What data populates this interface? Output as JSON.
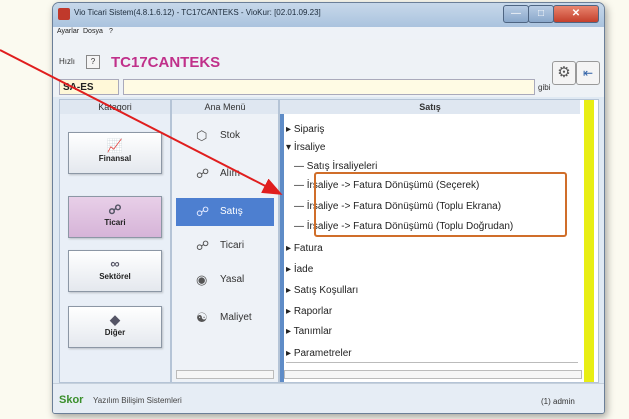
{
  "window": {
    "title": "Vio Ticari Sistem(4.8.1.6.12) - TC17CANTEKS - VioKur: [02.01.09.23]"
  },
  "menubar": {
    "items": [
      "Ayarlar",
      "Dosya",
      "?"
    ]
  },
  "toolbar": {
    "hizli_label": "Hızlı",
    "help_label": "?",
    "company": "TC17CANTEKS",
    "code": "SA-ES",
    "search_value": "",
    "gibi_label": "gibi"
  },
  "kategori": {
    "header": "Kategori",
    "items": [
      "Finansal",
      "Ticari",
      "Sektörel",
      "Diğer"
    ],
    "active": "Ticari"
  },
  "anamenu": {
    "header": "Ana Menü",
    "items": [
      "Stok",
      "Alım",
      "Satış",
      "Ticari",
      "Yasal",
      "Maliyet"
    ],
    "active": "Satış"
  },
  "satis": {
    "header": "Satış",
    "tree": [
      "Sipariş",
      "İrsaliye",
      "Satış İrsaliyeleri",
      "İrsaliye -> Fatura Dönüşümü (Seçerek)",
      "İrsaliye -> Fatura Dönüşümü (Toplu Ekrana)",
      "İrsaliye -> Fatura Dönüşümü (Toplu Doğrudan)",
      "Fatura",
      "İade",
      "Satış Koşulları",
      "Raporlar",
      "Tanımlar",
      "Parametreler"
    ]
  },
  "statusbar": {
    "brand": "Skor",
    "subtitle": "Yazılım Bilişim Sistemleri",
    "user": "(1) admin"
  },
  "colors": {
    "accent_pink": "#c0308a",
    "highlight_orange": "#d06e2a",
    "arrow_red": "#e01e1e",
    "active_blue": "#4d7fd0",
    "brand_green": "#3a8f2b"
  }
}
